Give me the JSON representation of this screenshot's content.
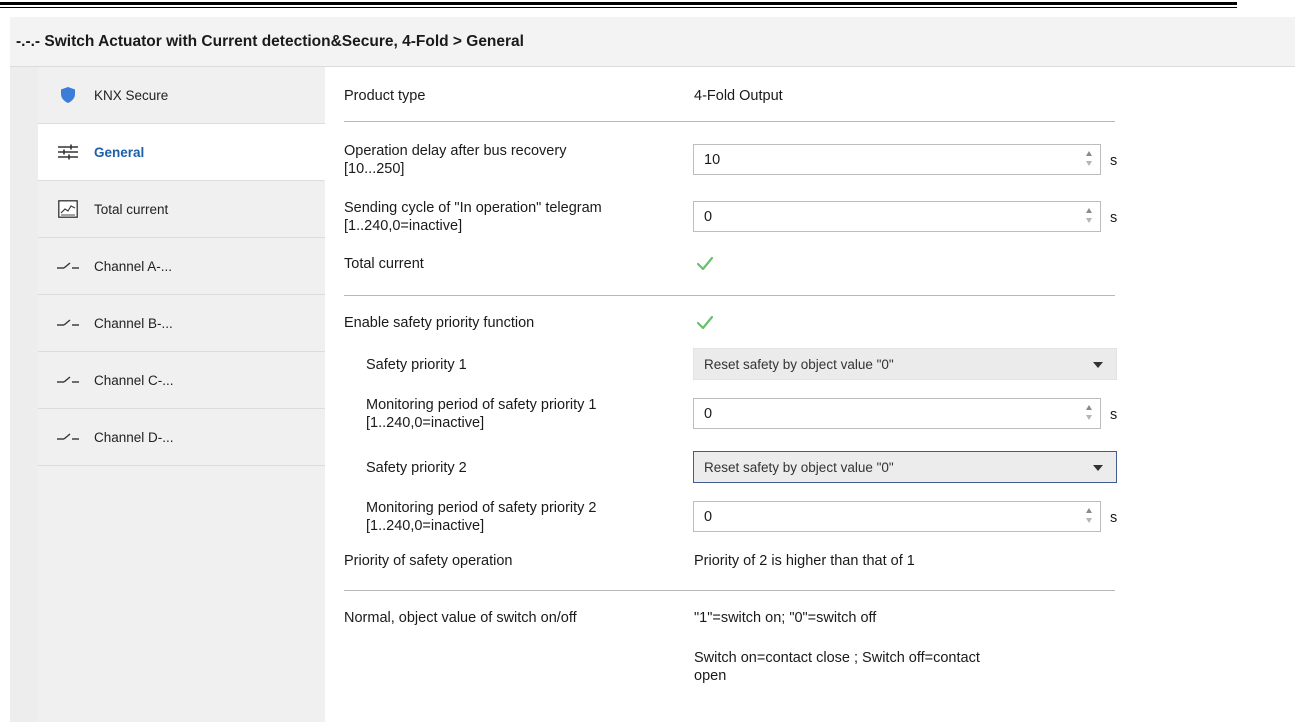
{
  "window": {
    "title": "-.-.- Switch Actuator with Current detection&Secure, 4-Fold > General"
  },
  "sidebar": {
    "items": [
      {
        "label": "KNX Secure",
        "icon": "shield-icon"
      },
      {
        "label": "General",
        "icon": "sliders-icon",
        "active": true
      },
      {
        "label": "Total current",
        "icon": "chart-icon"
      },
      {
        "label": "Channel A-...",
        "icon": "switch-contact-icon"
      },
      {
        "label": "Channel B-...",
        "icon": "switch-contact-icon"
      },
      {
        "label": "Channel C-...",
        "icon": "switch-contact-icon"
      },
      {
        "label": "Channel D-...",
        "icon": "switch-contact-icon"
      }
    ]
  },
  "params": {
    "product_type": {
      "label": "Product type",
      "value": "4-Fold Output"
    },
    "op_delay": {
      "label1": "Operation delay after bus recovery",
      "label2": "[10...250]",
      "value": "10",
      "unit": "s"
    },
    "send_cycle": {
      "label1": "Sending cycle of \"In operation\" telegram",
      "label2": "[1..240,0=inactive]",
      "value": "0",
      "unit": "s"
    },
    "total_current": {
      "label": "Total current",
      "checked": true
    },
    "enable_safety": {
      "label": "Enable safety priority function",
      "checked": true
    },
    "safety1": {
      "label": "Safety priority 1",
      "value": "Reset safety by object value \"0\""
    },
    "monitor1": {
      "label1": "Monitoring period of safety priority 1",
      "label2": "[1..240,0=inactive]",
      "value": "0",
      "unit": "s"
    },
    "safety2": {
      "label": "Safety priority 2",
      "value": "Reset safety by object value \"0\""
    },
    "monitor2": {
      "label1": "Monitoring period of safety priority 2",
      "label2": "[1..240,0=inactive]",
      "value": "0",
      "unit": "s"
    },
    "priority_op": {
      "label": "Priority of safety operation",
      "value": "Priority of 2 is higher than that of 1"
    },
    "normal_value": {
      "label": "Normal, object value of switch on/off",
      "value1": "\"1\"=switch on; \"0\"=switch off",
      "value2a": "Switch on=contact close ; Switch off=contact",
      "value2b": "open"
    }
  },
  "colors": {
    "accent": "#1d5fa8",
    "check": "#6bbf6b",
    "shield": "#3b7dd8"
  }
}
